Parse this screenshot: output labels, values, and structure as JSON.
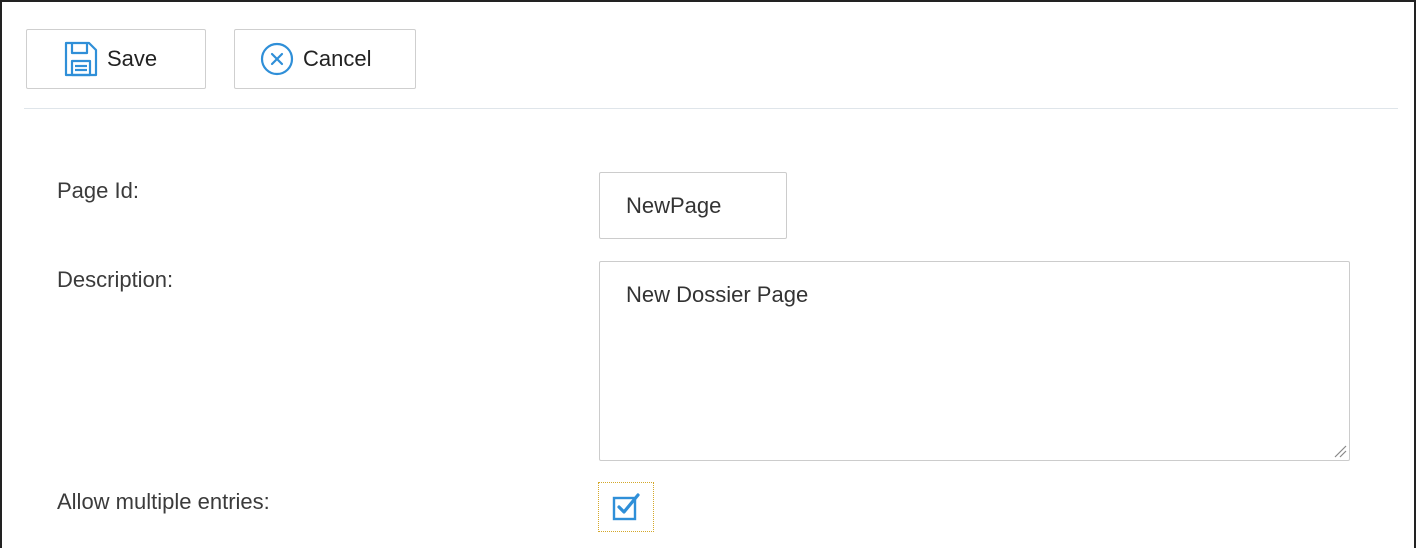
{
  "toolbar": {
    "save_label": "Save",
    "cancel_label": "Cancel",
    "save_icon": "save-icon",
    "cancel_icon": "cancel-icon"
  },
  "form": {
    "page_id": {
      "label": "Page Id:",
      "value": "NewPage"
    },
    "description": {
      "label": "Description:",
      "value": "New Dossier Page"
    },
    "allow_multiple": {
      "label": "Allow multiple entries:",
      "checked": true
    }
  },
  "colors": {
    "accent": "#2f8fd8",
    "border": "#cccccc",
    "focus_outline": "#d4a82a"
  }
}
